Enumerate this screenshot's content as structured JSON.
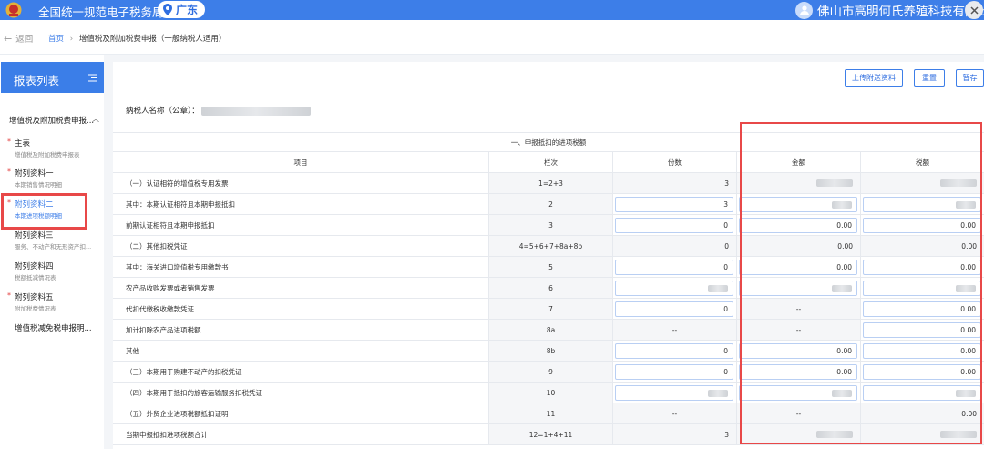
{
  "header": {
    "site_title": "全国统一规范电子税务局",
    "region": "广东",
    "user_name": "佛山市高明何氏养殖科技有限公司"
  },
  "breadcrumb": {
    "back": "返回",
    "home": "首页",
    "separator": "›",
    "current": "增值税及附加税费申报（一般纳税人适用）"
  },
  "sidebar": {
    "title": "报表列表",
    "group": "增值税及附加税费申报...",
    "items": [
      {
        "label": "主表",
        "sub": "增值税及附加税费申报表",
        "required": true
      },
      {
        "label": "附列资料一",
        "sub": "本期销售情况明细",
        "required": true
      },
      {
        "label": "附列资料二",
        "sub": "本期进项税额明细",
        "required": true
      },
      {
        "label": "附列资料三",
        "sub": "服务、不动产和无形资产扣...",
        "required": false
      },
      {
        "label": "附列资料四",
        "sub": "税额抵减情况表",
        "required": false
      },
      {
        "label": "附列资料五",
        "sub": "附加税费情况表",
        "required": true
      },
      {
        "label": "增值税减免税申报明...",
        "sub": "",
        "required": false
      }
    ]
  },
  "actions": {
    "upload": "上传附送资料",
    "reset": "重置",
    "save": "暂存"
  },
  "taxpayer_label": "纳税人名称（公章）：",
  "table": {
    "section_title": "一、申报抵扣的进项税额",
    "headers": [
      "项目",
      "栏次",
      "份数",
      "金额",
      "税额"
    ],
    "rows": [
      {
        "item": "（一）认证相符的增值税专用发票",
        "code": "1=2+3",
        "count": "3",
        "amount": "",
        "tax": ""
      },
      {
        "item": "其中：本期认证相符且本期申报抵扣",
        "code": "2",
        "count": "3",
        "amount": "",
        "tax": ""
      },
      {
        "item": "前期认证相符且本期申报抵扣",
        "code": "3",
        "count": "0",
        "amount": "0.00",
        "tax": "0.00"
      },
      {
        "item": "（二）其他扣税凭证",
        "code": "4=5+6+7+8a+8b",
        "count": "0",
        "amount": "0.00",
        "tax": "0.00"
      },
      {
        "item": "其中：海关进口增值税专用缴款书",
        "code": "5",
        "count": "0",
        "amount": "0.00",
        "tax": "0.00"
      },
      {
        "item": "农产品收购发票或者销售发票",
        "code": "6",
        "count": "",
        "amount": "",
        "tax": ""
      },
      {
        "item": "代扣代缴税收缴款凭证",
        "code": "7",
        "count": "0",
        "amount": "--",
        "tax": "0.00"
      },
      {
        "item": "加计扣除农产品进项税额",
        "code": "8a",
        "count": "--",
        "amount": "--",
        "tax": "0.00"
      },
      {
        "item": "其他",
        "code": "8b",
        "count": "0",
        "amount": "0.00",
        "tax": "0.00"
      },
      {
        "item": "（三）本期用于购建不动产的扣税凭证",
        "code": "9",
        "count": "0",
        "amount": "0.00",
        "tax": "0.00"
      },
      {
        "item": "（四）本期用于抵扣的旅客运输服务扣税凭证",
        "code": "10",
        "count": "",
        "amount": "",
        "tax": ""
      },
      {
        "item": "（五）外贸企业进项税额抵扣证明",
        "code": "11",
        "count": "--",
        "amount": "--",
        "tax": "0.00"
      },
      {
        "item": "当期申报抵扣进项税额合计",
        "code": "12=1+4+11",
        "count": "3",
        "amount": "",
        "tax": ""
      }
    ]
  }
}
